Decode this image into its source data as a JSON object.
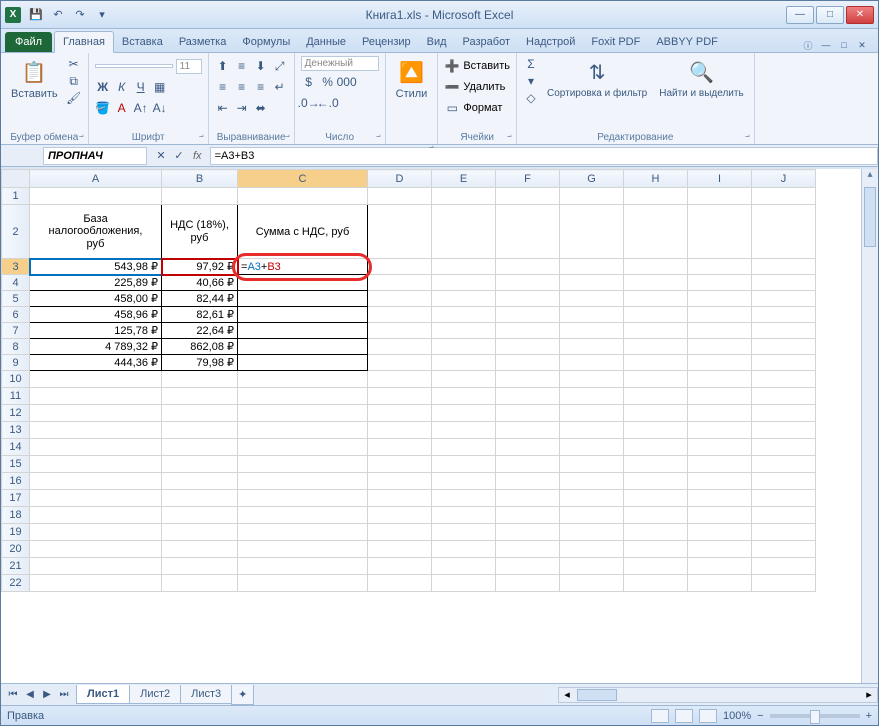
{
  "title": "Книга1.xls  -  Microsoft Excel",
  "qat": {
    "save": "💾",
    "undo": "↶",
    "redo": "↷"
  },
  "tabs": {
    "file": "Файл",
    "items": [
      "Главная",
      "Вставка",
      "Разметка",
      "Формулы",
      "Данные",
      "Рецензир",
      "Вид",
      "Разработ",
      "Надстрой",
      "Foxit PDF",
      "ABBYY PDF"
    ],
    "active": "Главная"
  },
  "ribbon": {
    "clipboard": {
      "paste": "Вставить",
      "label": "Буфер обмена"
    },
    "font": {
      "name": "",
      "size": "11",
      "label": "Шрифт"
    },
    "align": {
      "label": "Выравнивание"
    },
    "number": {
      "format": "Денежный",
      "label": "Число"
    },
    "styles": {
      "btn": "Стили",
      "label": ""
    },
    "cells": {
      "insert": "Вставить",
      "delete": "Удалить",
      "format": "Формат",
      "label": "Ячейки"
    },
    "editing": {
      "sort": "Сортировка и фильтр",
      "find": "Найти и выделить",
      "label": "Редактирование"
    }
  },
  "name_box": "ПРОПНАЧ",
  "formula": {
    "prefix": "=",
    "ref1": "A3",
    "op": "+",
    "ref2": "B3"
  },
  "columns": [
    "A",
    "B",
    "C",
    "D",
    "E",
    "F",
    "G",
    "H",
    "I",
    "J"
  ],
  "headers": {
    "A": "База\nналогообложения,\nруб",
    "B": "НДС (18%),\nруб",
    "C": "Сумма с НДС,\nруб"
  },
  "editing_cell": "=A3+B3",
  "rows": [
    {
      "a": "543,98 ₽",
      "b": "97,92 ₽"
    },
    {
      "a": "225,89 ₽",
      "b": "40,66 ₽"
    },
    {
      "a": "458,00 ₽",
      "b": "82,44 ₽"
    },
    {
      "a": "458,96 ₽",
      "b": "82,61 ₽"
    },
    {
      "a": "125,78 ₽",
      "b": "22,64 ₽"
    },
    {
      "a": "4 789,32 ₽",
      "b": "862,08 ₽"
    },
    {
      "a": "444,36 ₽",
      "b": "79,98 ₽"
    }
  ],
  "sheets": [
    "Лист1",
    "Лист2",
    "Лист3"
  ],
  "active_sheet": "Лист1",
  "status": "Правка",
  "zoom": "100%"
}
